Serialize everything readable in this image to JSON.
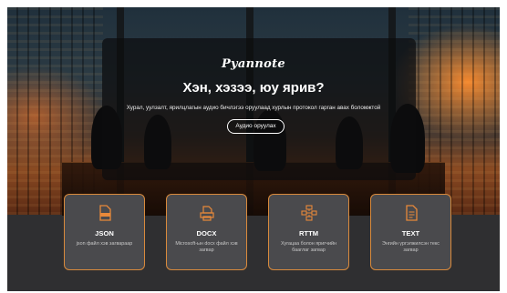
{
  "hero": {
    "brand": "Pyannote",
    "headline": "Хэн, хэзээ, юу ярив?",
    "subtitle": "Хурал, уулзалт, ярилцлагын аудио бичлэгээ оруулаад хурлын протокол гарган авах боломжтой",
    "upload_label": "Аудио оруулах"
  },
  "formats": [
    {
      "label": "JSON",
      "desc": "json файл хэв загвараар",
      "icon": "json-file-icon"
    },
    {
      "label": "DOCX",
      "desc": "Microsoft-ын docx файл хэв загвар",
      "icon": "printer-icon"
    },
    {
      "label": "RTTM",
      "desc": "Хугацаа болон яригчийн бааглаг загвар",
      "icon": "diagram-icon"
    },
    {
      "label": "TEXT",
      "desc": "Энгийн үргэлжилсэн текс загвар",
      "icon": "text-file-icon"
    }
  ],
  "colors": {
    "accent": "#d98a3c",
    "card_bg": "#4a4a4d",
    "panel_bg": "#2f2f31"
  }
}
